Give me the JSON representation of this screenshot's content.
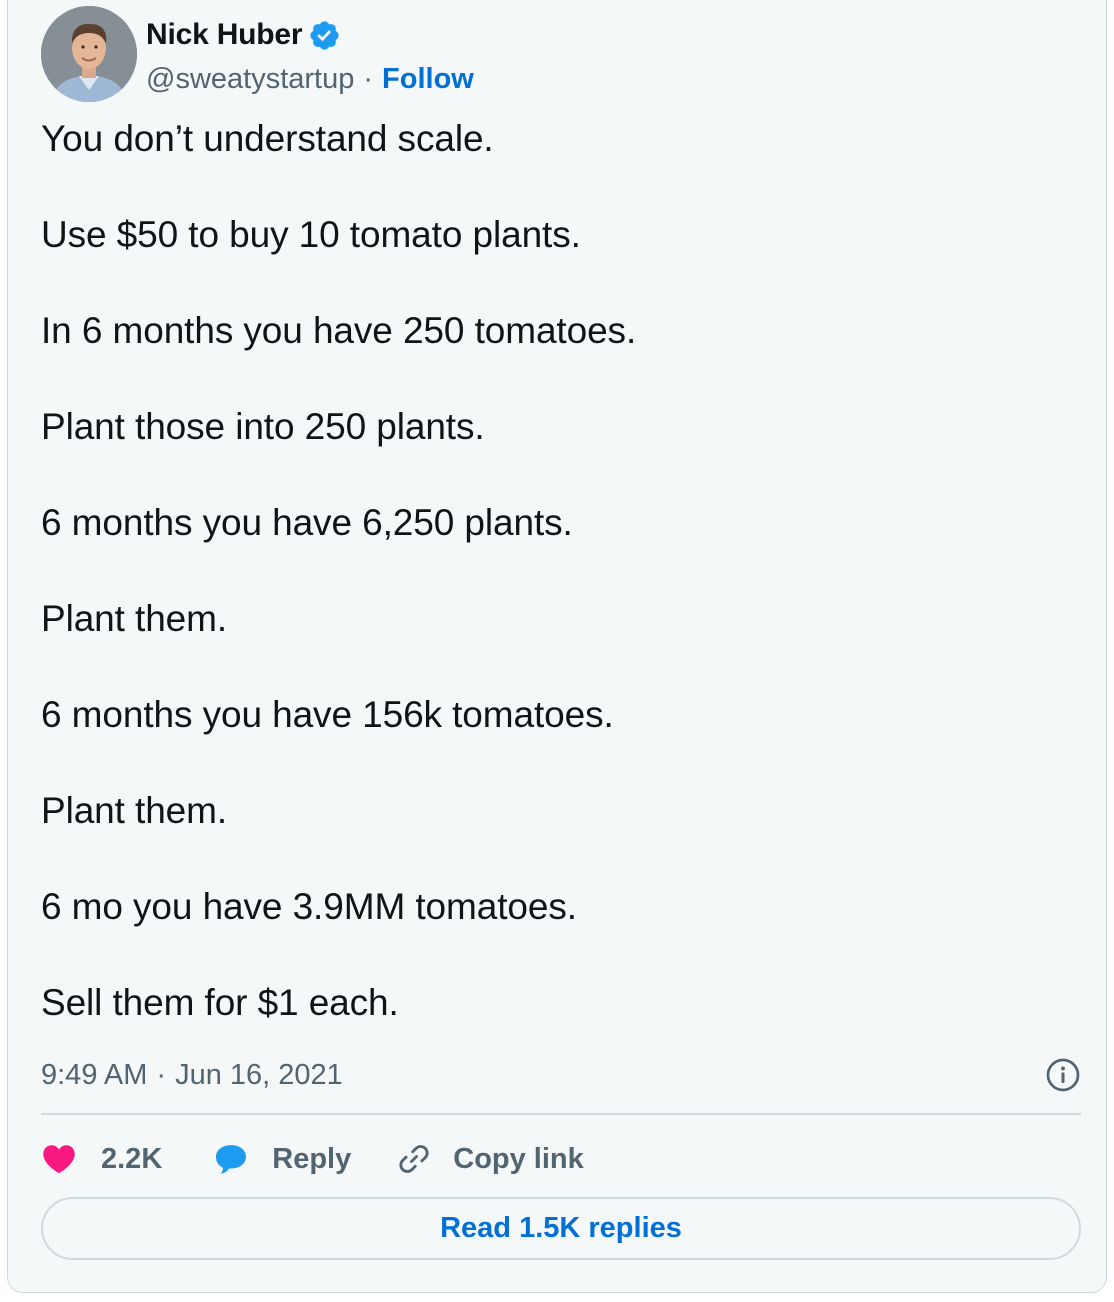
{
  "author": {
    "name": "Nick Huber",
    "handle": "@sweatystartup",
    "follow_label": "Follow",
    "verified": true
  },
  "tweet": {
    "lines": [
      "You don’t understand scale.",
      "Use $50 to buy 10 tomato plants.",
      "In 6 months you have 250 tomatoes.",
      "Plant those into 250 plants.",
      "6 months you have 6,250 plants.",
      "Plant them.",
      "6 months you have 156k tomatoes.",
      "Plant them.",
      "6 mo you have 3.9MM tomatoes.",
      "Sell them for $1 each."
    ],
    "time": "9:49 AM",
    "separator": "·",
    "date": "Jun 16, 2021"
  },
  "actions": {
    "like_count": "2.2K",
    "reply_label": "Reply",
    "copy_link_label": "Copy link"
  },
  "read_replies_label": "Read 1.5K replies",
  "icons": {
    "verified": "verified-badge-icon",
    "info": "info-icon",
    "like": "heart-icon",
    "reply": "speech-bubble-icon",
    "copy": "link-icon"
  },
  "colors": {
    "accent_blue": "#006fd6",
    "verified_blue": "#1d9bf0",
    "like_pink": "#f91880",
    "text_primary": "#0f1419",
    "text_secondary": "#536471",
    "border": "#cfd9de",
    "card_bg": "#f5f8f8"
  }
}
